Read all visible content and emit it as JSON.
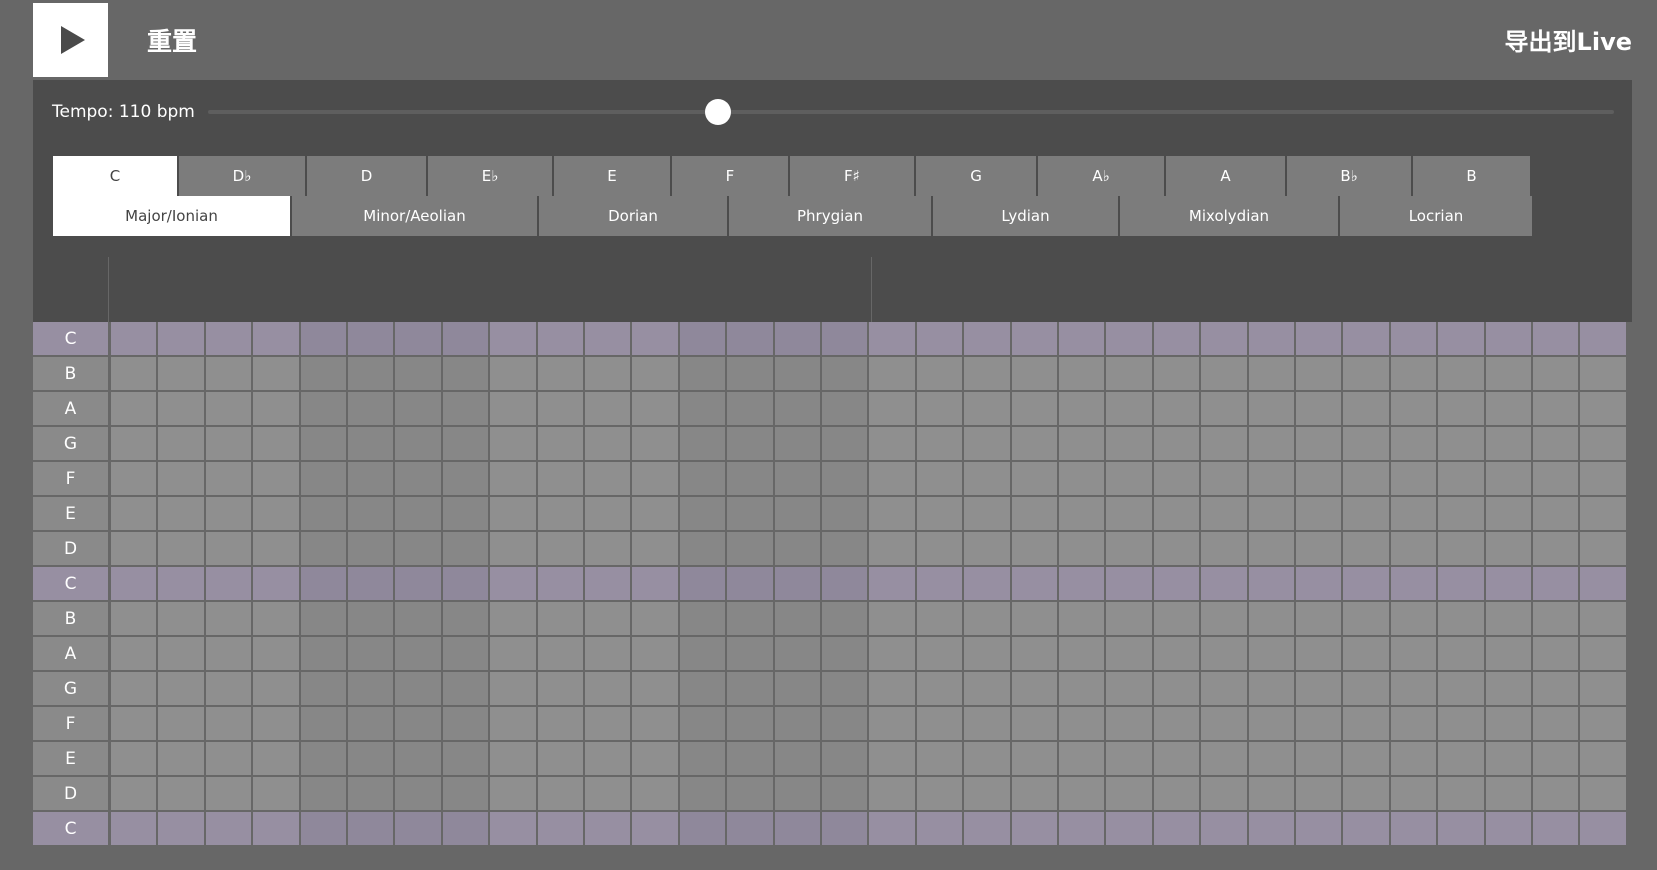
{
  "toolbar": {
    "reset_label": "重置",
    "export_label": "导出到Live"
  },
  "tempo": {
    "label": "Tempo: 110 bpm",
    "value": 110,
    "fraction": 0.363
  },
  "keys": {
    "items": [
      "C",
      "D♭",
      "D",
      "E♭",
      "E",
      "F",
      "F♯",
      "G",
      "A♭",
      "A",
      "B♭",
      "B"
    ],
    "selected": 0
  },
  "modes": {
    "items": [
      "Major/Ionian",
      "Minor/Aeolian",
      "Dorian",
      "Phrygian",
      "Lydian",
      "Mixolydian",
      "Locrian"
    ],
    "selected": 0
  },
  "grid": {
    "rows": [
      "C",
      "B",
      "A",
      "G",
      "F",
      "E",
      "D",
      "C",
      "B",
      "A",
      "G",
      "F",
      "E",
      "D",
      "C"
    ],
    "tonic_note": "C",
    "steps": 32
  },
  "colors": {
    "background": "#676767",
    "panel": "#4c4c4c",
    "cell": "#8f8f8f",
    "tonic_cell": "#978fa2",
    "active_button": "#ffffff"
  }
}
